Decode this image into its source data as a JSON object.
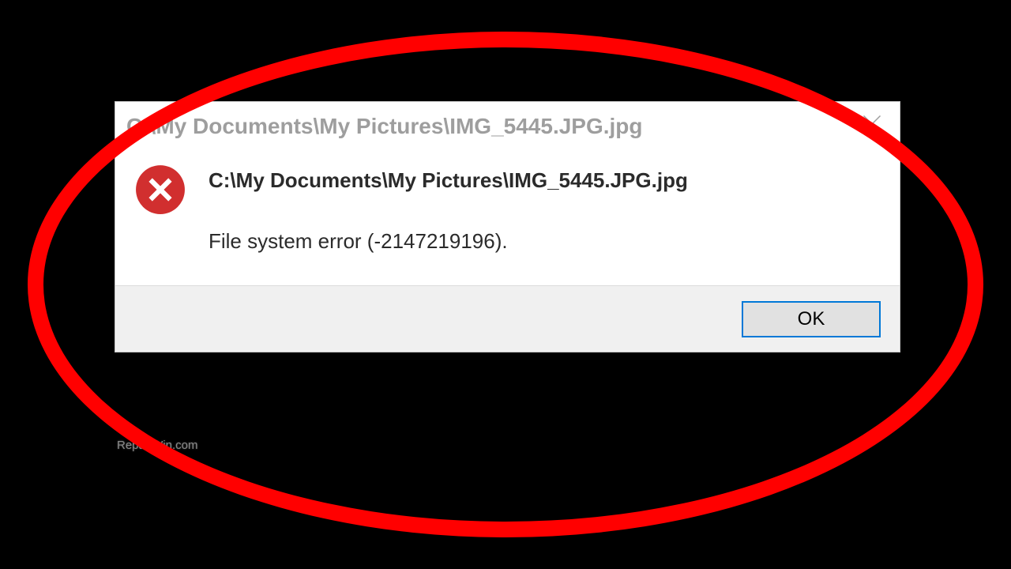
{
  "dialog": {
    "title": "C:\\My Documents\\My Pictures\\IMG_5445.JPG.jpg",
    "message_path": "C:\\My Documents\\My Pictures\\IMG_5445.JPG.jpg",
    "error_text": "File system error (-2147219196).",
    "ok_label": "OK",
    "icon": "error-circle",
    "close_icon": "close-x"
  },
  "watermark": "RepairWin.com",
  "colors": {
    "error_red": "#d12f2f",
    "focus_blue": "#0078d7",
    "title_gray": "#9e9e9e"
  }
}
